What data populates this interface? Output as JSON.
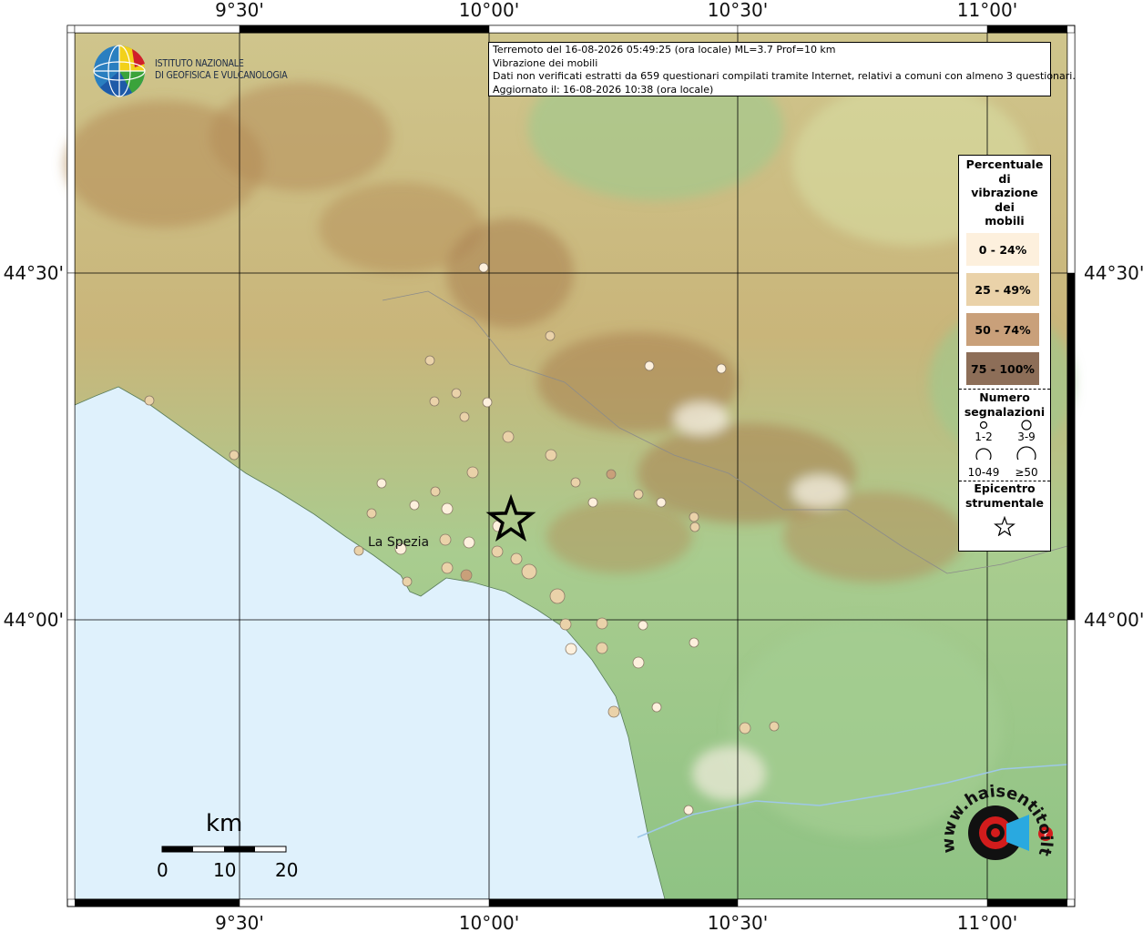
{
  "info": {
    "line1": "Terremoto del 16-08-2026 05:49:25 (ora locale) ML=3.7 Prof=10 km",
    "line2": "Vibrazione dei mobili",
    "line3": "Dati non verificati estratti da 659 questionari compilati tramite Internet, relativi a comuni con almeno 3 questionari.",
    "line4": "Aggiornato il: 16-08-2026 10:38 (ora locale)"
  },
  "logo": {
    "line1": "ISTITUTO NAZIONALE",
    "line2": "DI GEOFISICA E VULCANOLOGIA"
  },
  "axes": {
    "lon_labels": [
      "9°30'",
      "10°00'",
      "10°30'",
      "11°00'"
    ],
    "lat_labels": [
      "44°30'",
      "44°00'"
    ]
  },
  "city": {
    "name": "La Spezia"
  },
  "legend": {
    "title": [
      "Percentuale",
      "di",
      "vibrazione",
      "dei",
      "mobili"
    ],
    "classes": [
      {
        "label": "0 - 24%",
        "color": "#fdf0dd"
      },
      {
        "label": "25 - 49%",
        "color": "#ead2a9"
      },
      {
        "label": "50 - 74%",
        "color": "#c9a07a"
      },
      {
        "label": "75 - 100%",
        "color": "#8d6e58"
      }
    ],
    "count_title": [
      "Numero",
      "segnalazioni"
    ],
    "count_labels": [
      "1-2",
      "3-9",
      "10-49",
      "≥50"
    ],
    "epicenter_title": [
      "Epicentro",
      "strumentale"
    ]
  },
  "scale": {
    "unit": "km",
    "ticks": [
      "0",
      "10",
      "20"
    ]
  },
  "brand": {
    "text": "haisentitoilterremoto.it",
    "sub": "www."
  },
  "colors": {
    "sea": "#dff1fc",
    "lowland": "#9cc98d",
    "hill": "#d6cf98",
    "mountain": "#b48a55",
    "peak": "#f3ecdf"
  }
}
